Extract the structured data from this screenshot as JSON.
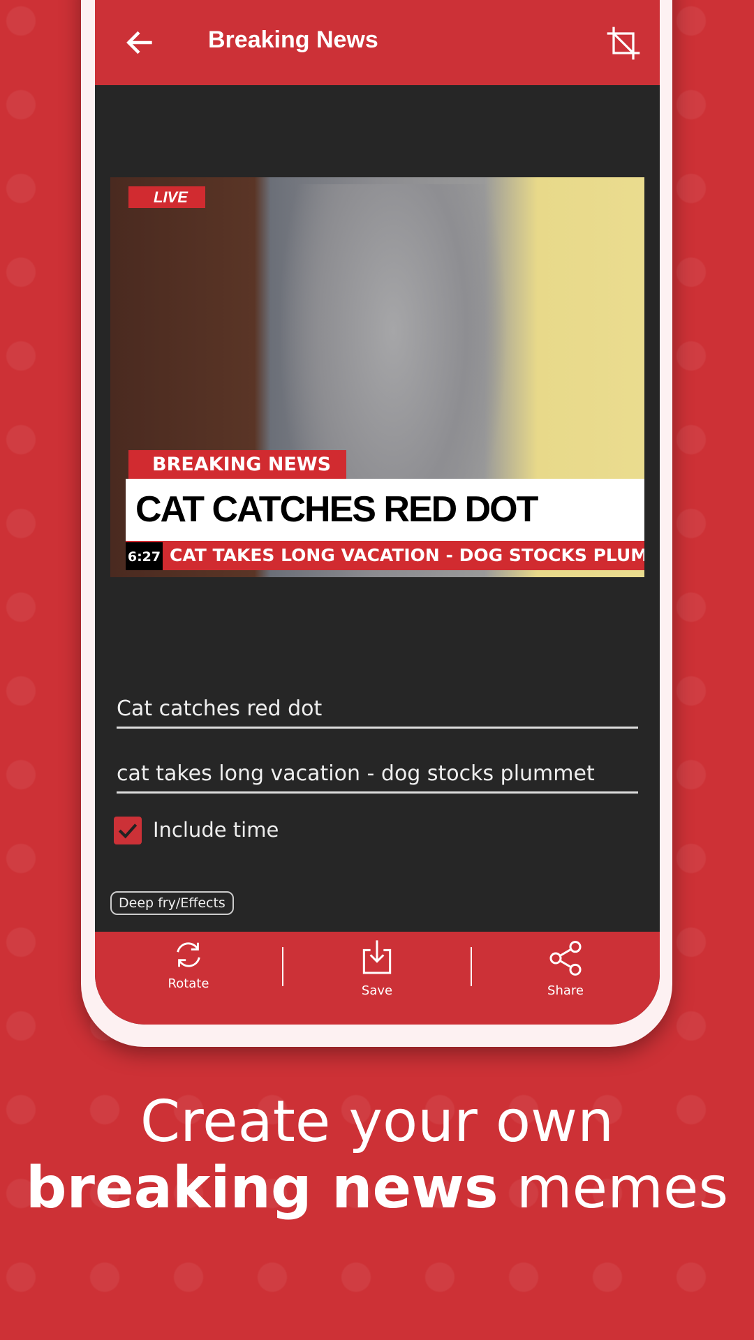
{
  "app_bar": {
    "title": "Breaking News",
    "back_icon": "arrow-left-icon",
    "crop_icon": "crop-icon"
  },
  "meme": {
    "live_label": "LIVE",
    "tag": "BREAKING NEWS",
    "headline": "CAT CATCHES RED DOT",
    "time": "6:27",
    "ticker": "CAT TAKES LONG VACATION - DOG STOCKS PLUMMET"
  },
  "form": {
    "headline_value": "Cat catches red dot",
    "ticker_value": "cat takes long vacation - dog stocks plummet",
    "include_time_label": "Include time",
    "include_time_checked": true,
    "effects_label": "Deep fry/Effects"
  },
  "bottom_bar": {
    "rotate": "Rotate",
    "save": "Save",
    "share": "Share"
  },
  "caption": {
    "line1": "Create your own",
    "line2_bold": "breaking news",
    "line2_rest": " memes"
  },
  "colors": {
    "accent": "#cc3137",
    "dark": "#262626"
  }
}
